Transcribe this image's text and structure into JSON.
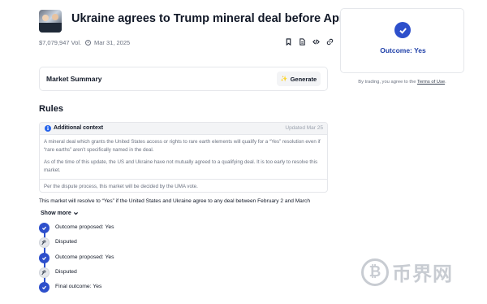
{
  "market": {
    "title": "Ukraine agrees to Trump mineral deal before April?",
    "volume": "$7,079,947 Vol.",
    "end_date": "Mar 31, 2025",
    "action_icons": [
      "bookmark-icon",
      "document-icon",
      "code-icon",
      "link-icon"
    ]
  },
  "summary": {
    "label": "Market Summary",
    "generate_label": "Generate"
  },
  "rules": {
    "heading": "Rules",
    "context": {
      "title": "Additional context",
      "updated": "Updated Mar 25",
      "paragraphs": [
        "A mineral deal which grants the United States access or rights to rare earth elements will qualify for a “Yes” resolution even if “rare earths” aren’t specifically named in the deal.",
        "As of the time of this update, the US and Ukraine have not mutually agreed to a qualifying deal. It is too early to resolve this market.",
        "Per the dispute process, this market will be decided by the UMA vote."
      ]
    },
    "resolution_text": "This market will resolve to “Yes” if the United States and Ukraine agree to any deal between February 2 and March",
    "show_more": "Show more"
  },
  "timeline": [
    {
      "label": "Outcome proposed: Yes",
      "icon": "check-icon",
      "status": "done"
    },
    {
      "label": "Disputed",
      "icon": "gavel-icon",
      "status": "disputed"
    },
    {
      "label": "Outcome proposed: Yes",
      "icon": "check-icon",
      "status": "done"
    },
    {
      "label": "Disputed",
      "icon": "gavel-icon",
      "status": "disputed"
    },
    {
      "label": "Final outcome: Yes",
      "icon": "check-icon",
      "status": "done"
    }
  ],
  "outcome": {
    "label": "Outcome: Yes"
  },
  "terms": {
    "prefix": "By trading, you agree to the",
    "link": "Terms of Use",
    "suffix": "."
  },
  "watermark": {
    "text": "币界网",
    "logo": "₿"
  },
  "colors": {
    "accent": "#2d4fcb",
    "outcome_text": "#1e3fa8"
  }
}
